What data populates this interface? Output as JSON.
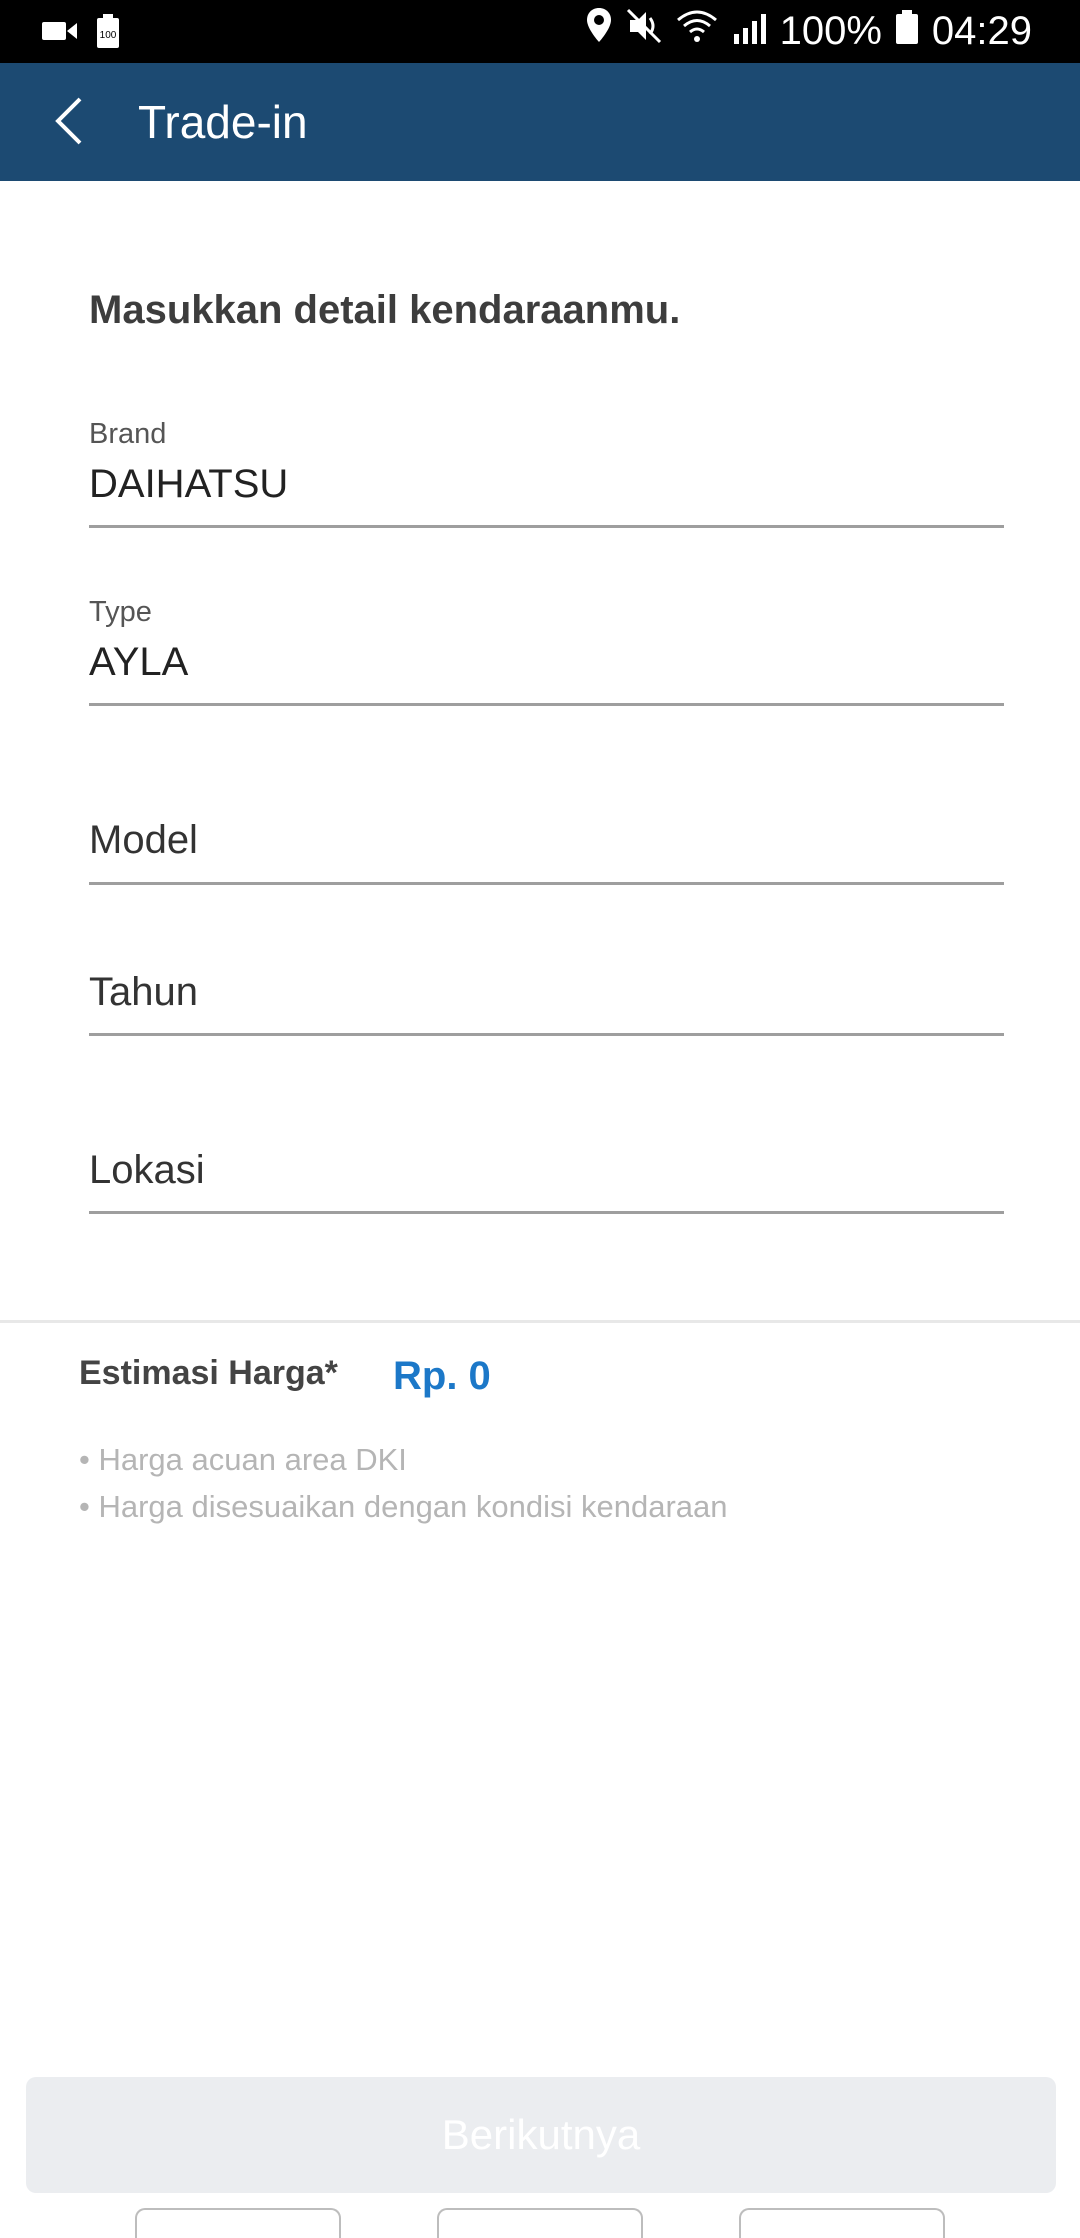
{
  "status_bar": {
    "battery_percent": "100%",
    "time": "04:29",
    "small_battery_label": "100"
  },
  "app_bar": {
    "title": "Trade-in"
  },
  "form": {
    "heading": "Masukkan detail kendaraanmu.",
    "brand": {
      "label": "Brand",
      "value": "DAIHATSU"
    },
    "type": {
      "label": "Type",
      "value": "AYLA"
    },
    "model": {
      "placeholder": "Model"
    },
    "tahun": {
      "placeholder": "Tahun"
    },
    "lokasi": {
      "placeholder": "Lokasi"
    }
  },
  "estimate": {
    "label": "Estimasi Harga*",
    "value": "Rp. 0",
    "notes": [
      "• Harga acuan area DKI",
      "• Harga disesuaikan dengan kondisi kendaraan"
    ]
  },
  "footer": {
    "next_label": "Berikutnya"
  },
  "colors": {
    "app_bar": "#1c4a72",
    "accent": "#1c78c8",
    "button_disabled": "#ebedf0"
  }
}
